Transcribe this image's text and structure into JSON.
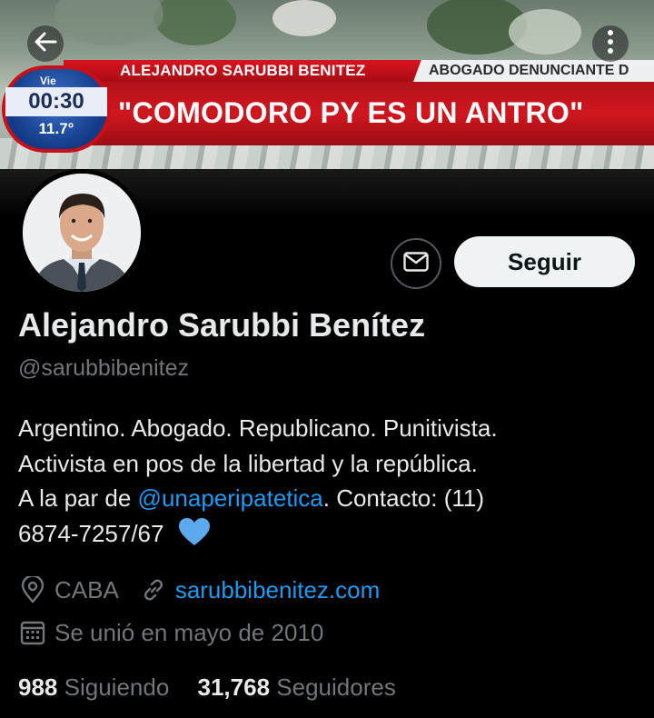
{
  "banner": {
    "ticker_name": "ALEJANDRO SARUBBI BENITEZ",
    "ticker_role": "ABOGADO DENUNCIANTE D",
    "headline": "\"COMODORO PY ES UN ANTRO\"",
    "clock": {
      "day": "Vie",
      "time": "00:30",
      "temp": "11.7°"
    }
  },
  "nav": {
    "back_icon": "arrow-left-icon",
    "more_icon": "more-vertical-icon"
  },
  "actions": {
    "message_icon": "envelope-icon",
    "follow_label": "Seguir"
  },
  "profile": {
    "display_name": "Alejandro Sarubbi Benítez",
    "handle": "@sarubbibenitez",
    "bio_text_1": "Argentino. Abogado. Republicano. Punitivista.",
    "bio_text_2": "Activista en pos de la libertad y la república.",
    "bio_text_3a": "A la par de ",
    "bio_mention": "@unaperipatetica",
    "bio_text_3b": ". Contacto: (11)",
    "bio_text_4": "6874-7257/67",
    "bio_emoji": "blue-heart-icon",
    "location": "CABA",
    "website": "sarubbibenitez.com",
    "joined": "Se unió en mayo de 2010"
  },
  "stats": {
    "following_count": "988",
    "following_label": "Siguiendo",
    "followers_count": "31,768",
    "followers_label": "Seguidores"
  },
  "colors": {
    "background": "#000000",
    "text_primary": "#e7e9ea",
    "text_secondary": "#71767b",
    "accent": "#1d9bf0",
    "follow_button_bg": "#eff3f4",
    "ticker_red": "#d0161f"
  }
}
